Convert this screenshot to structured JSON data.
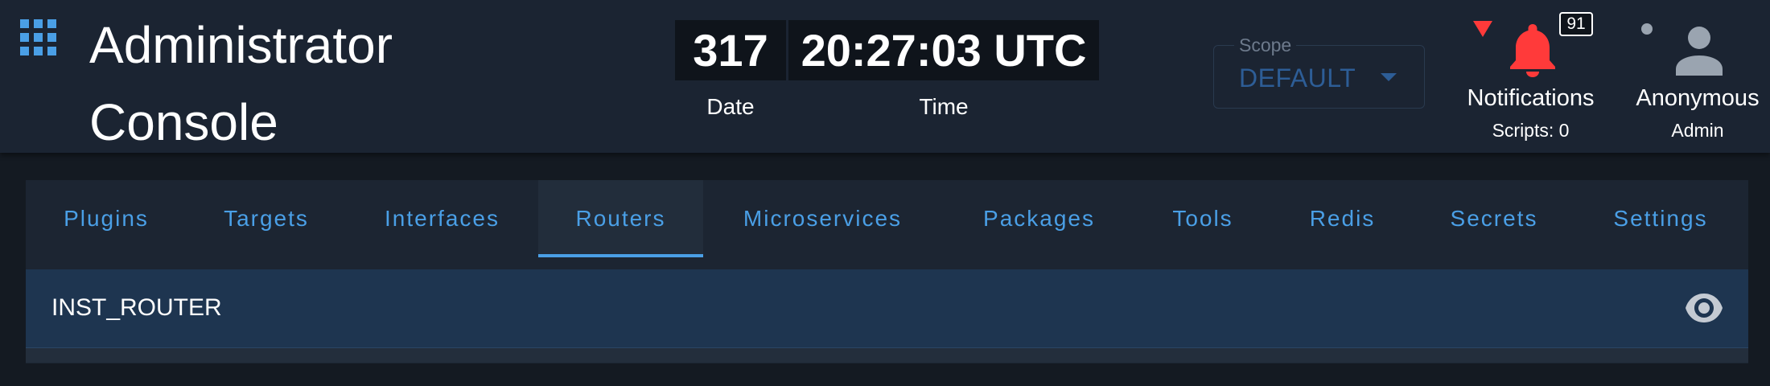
{
  "header": {
    "title": "Administrator Console",
    "menu_icon": "apps-grid-icon"
  },
  "clock": {
    "date_value": "317",
    "date_label": "Date",
    "time_value": "20:27:03 UTC",
    "time_label": "Time"
  },
  "scope": {
    "label": "Scope",
    "value": "DEFAULT"
  },
  "notifications": {
    "label": "Notifications",
    "count": "91",
    "scripts_status": "Scripts: 0",
    "icon": "bell-icon",
    "alert_color": "#ff3a3a"
  },
  "user": {
    "name": "Anonymous",
    "role": "Admin",
    "icon": "person-icon"
  },
  "tabs": [
    {
      "label": "Plugins",
      "active": false
    },
    {
      "label": "Targets",
      "active": false
    },
    {
      "label": "Interfaces",
      "active": false
    },
    {
      "label": "Routers",
      "active": true
    },
    {
      "label": "Microservices",
      "active": false
    },
    {
      "label": "Packages",
      "active": false
    },
    {
      "label": "Tools",
      "active": false
    },
    {
      "label": "Redis",
      "active": false
    },
    {
      "label": "Secrets",
      "active": false
    },
    {
      "label": "Settings",
      "active": false
    }
  ],
  "routers": [
    {
      "name": "INST_ROUTER",
      "action_icon": "eye-icon"
    }
  ],
  "colors": {
    "accent": "#4a9fe6",
    "header_bg": "#1b2432",
    "page_bg": "#141a22",
    "row_highlight": "#1e3550",
    "scope_text": "#2d5d96"
  }
}
